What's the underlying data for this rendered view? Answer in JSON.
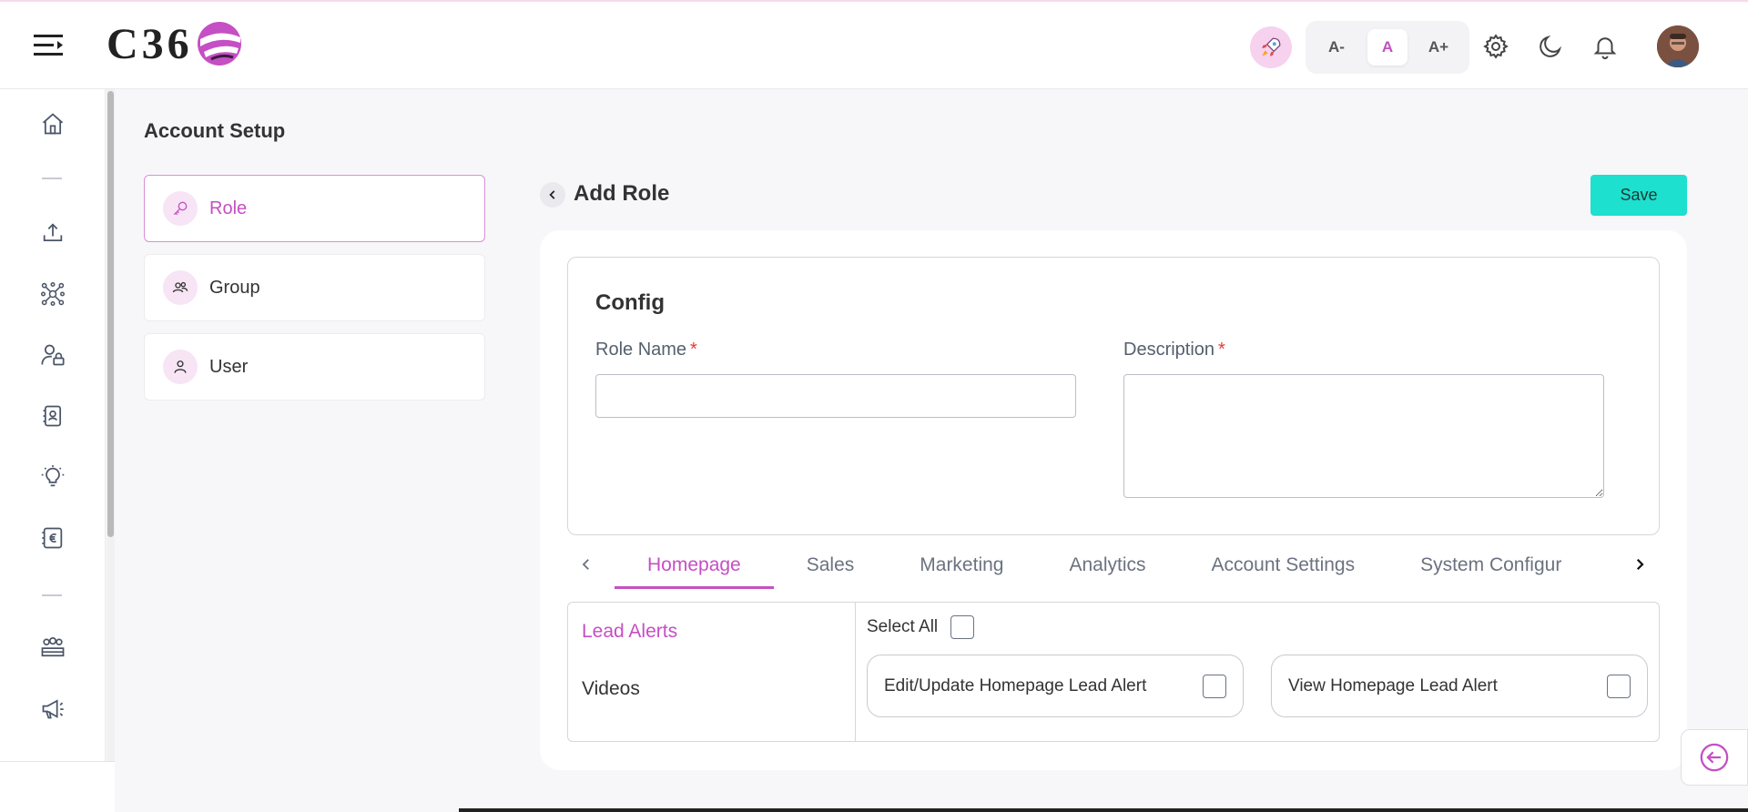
{
  "header": {
    "logo_text": "C36",
    "font_controls": [
      "A-",
      "A",
      "A+"
    ],
    "icons": [
      "menu-icon",
      "rocket-icon",
      "gear-icon",
      "moon-icon",
      "bell-icon"
    ]
  },
  "rail": {
    "icons": [
      "home-icon",
      "upload-icon",
      "network-icon",
      "user-lock-icon",
      "id-badge-icon",
      "lightbulb-icon",
      "currency-card-icon",
      "team-icon",
      "megaphone-icon"
    ]
  },
  "page": {
    "title": "Account Setup",
    "menu": [
      {
        "label": "Role",
        "icon": "key-icon",
        "active": true
      },
      {
        "label": "Group",
        "icon": "group-icon",
        "active": false
      },
      {
        "label": "User",
        "icon": "user-icon",
        "active": false
      }
    ]
  },
  "form": {
    "title": "Add Role",
    "save_label": "Save",
    "config_title": "Config",
    "role_name_label": "Role Name",
    "description_label": "Description",
    "required_mark": "*",
    "role_name_value": "",
    "description_value": ""
  },
  "tabs": [
    "Homepage",
    "Sales",
    "Marketing",
    "Analytics",
    "Account Settings",
    "System Configur"
  ],
  "active_tab": "Homepage",
  "permissions": {
    "sub_items": [
      "Lead Alerts",
      "Videos"
    ],
    "active_sub_item": "Lead Alerts",
    "select_all_label": "Select All",
    "items": [
      {
        "label": "Edit/Update Homepage Lead Alert",
        "checked": false
      },
      {
        "label": "View Homepage Lead Alert",
        "checked": false
      }
    ]
  },
  "colors": {
    "accent": "#c54fc4",
    "save_button": "#1de0cf",
    "required": "#e53935"
  }
}
